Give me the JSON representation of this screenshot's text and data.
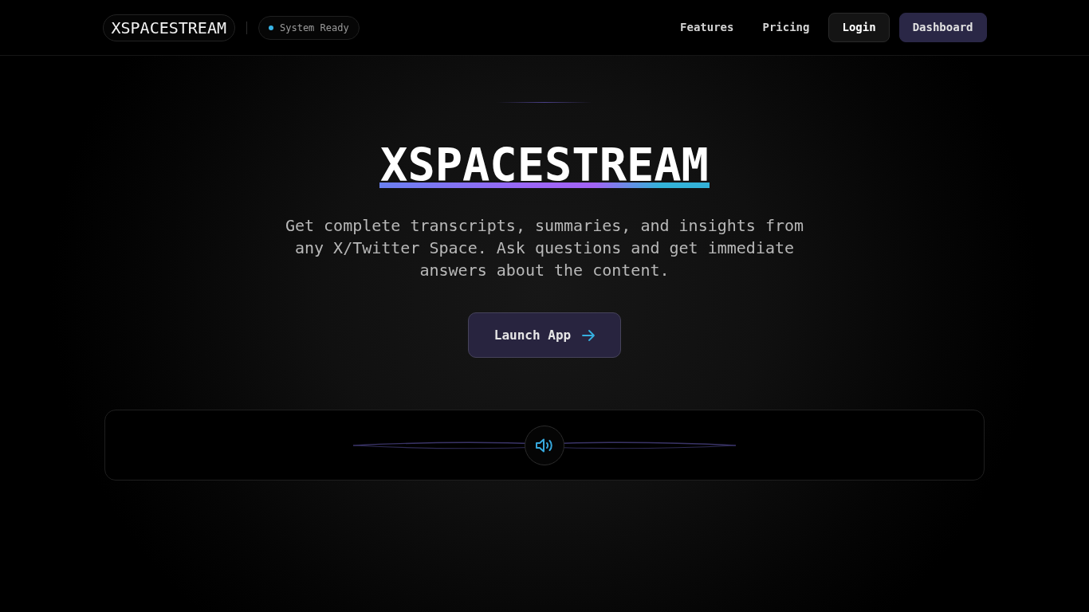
{
  "header": {
    "brand": "XSPACESTREAM",
    "status": {
      "label": "System Ready"
    },
    "nav": [
      {
        "label": "Features",
        "kind": "link"
      },
      {
        "label": "Pricing",
        "kind": "link"
      },
      {
        "label": "Login",
        "kind": "button"
      },
      {
        "label": "Dashboard",
        "kind": "primary"
      }
    ]
  },
  "hero": {
    "title": "XSPACESTREAM",
    "description": "Get complete transcripts, summaries, and insights from any X/Twitter Space. Ask questions and get immediate answers about the content.",
    "cta": "Launch App"
  },
  "player": {
    "muted": false
  }
}
